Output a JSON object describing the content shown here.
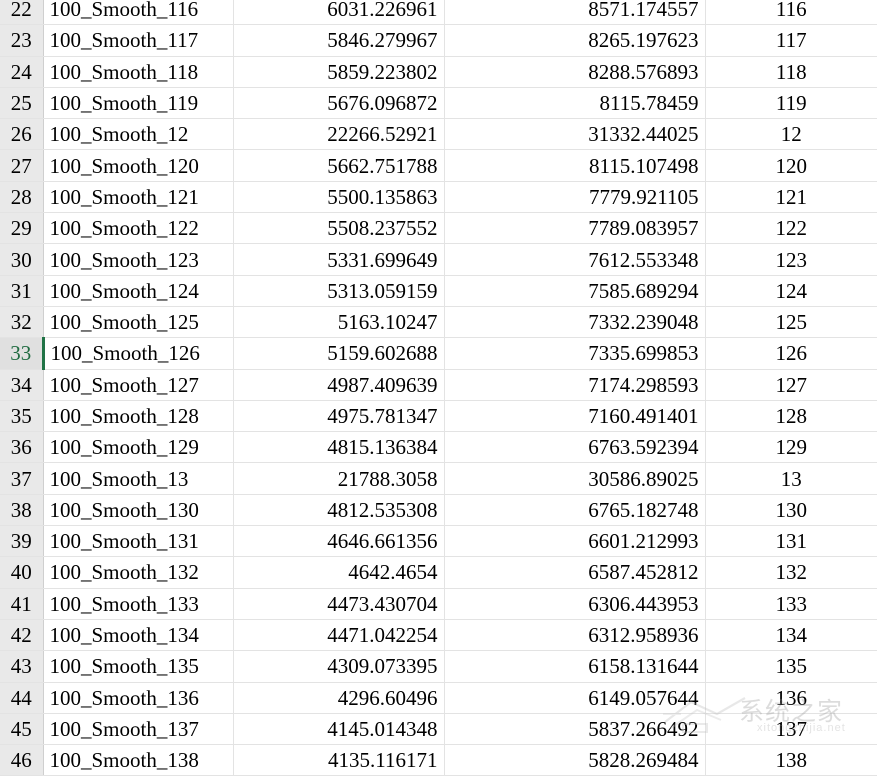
{
  "spreadsheet": {
    "active_row_number": "33",
    "accent_color": "#217346",
    "row_header_bg": "#e9e9e9",
    "gridline_color": "#e3e3e3",
    "columns": [
      {
        "key": "label",
        "align": "left"
      },
      {
        "key": "value1",
        "align": "right"
      },
      {
        "key": "value2",
        "align": "right"
      },
      {
        "key": "index",
        "align": "center"
      }
    ],
    "rows": [
      {
        "row": "22",
        "label": "100_Smooth_116",
        "value1": "6031.226961",
        "value2": "8571.174557",
        "index": "116"
      },
      {
        "row": "23",
        "label": "100_Smooth_117",
        "value1": "5846.279967",
        "value2": "8265.197623",
        "index": "117"
      },
      {
        "row": "24",
        "label": "100_Smooth_118",
        "value1": "5859.223802",
        "value2": "8288.576893",
        "index": "118"
      },
      {
        "row": "25",
        "label": "100_Smooth_119",
        "value1": "5676.096872",
        "value2": "8115.78459",
        "index": "119"
      },
      {
        "row": "26",
        "label": "100_Smooth_12",
        "value1": "22266.52921",
        "value2": "31332.44025",
        "index": "12"
      },
      {
        "row": "27",
        "label": "100_Smooth_120",
        "value1": "5662.751788",
        "value2": "8115.107498",
        "index": "120"
      },
      {
        "row": "28",
        "label": "100_Smooth_121",
        "value1": "5500.135863",
        "value2": "7779.921105",
        "index": "121"
      },
      {
        "row": "29",
        "label": "100_Smooth_122",
        "value1": "5508.237552",
        "value2": "7789.083957",
        "index": "122"
      },
      {
        "row": "30",
        "label": "100_Smooth_123",
        "value1": "5331.699649",
        "value2": "7612.553348",
        "index": "123"
      },
      {
        "row": "31",
        "label": "100_Smooth_124",
        "value1": "5313.059159",
        "value2": "7585.689294",
        "index": "124"
      },
      {
        "row": "32",
        "label": "100_Smooth_125",
        "value1": "5163.10247",
        "value2": "7332.239048",
        "index": "125"
      },
      {
        "row": "33",
        "label": "100_Smooth_126",
        "value1": "5159.602688",
        "value2": "7335.699853",
        "index": "126"
      },
      {
        "row": "34",
        "label": "100_Smooth_127",
        "value1": "4987.409639",
        "value2": "7174.298593",
        "index": "127"
      },
      {
        "row": "35",
        "label": "100_Smooth_128",
        "value1": "4975.781347",
        "value2": "7160.491401",
        "index": "128"
      },
      {
        "row": "36",
        "label": "100_Smooth_129",
        "value1": "4815.136384",
        "value2": "6763.592394",
        "index": "129"
      },
      {
        "row": "37",
        "label": "100_Smooth_13",
        "value1": "21788.3058",
        "value2": "30586.89025",
        "index": "13"
      },
      {
        "row": "38",
        "label": "100_Smooth_130",
        "value1": "4812.535308",
        "value2": "6765.182748",
        "index": "130"
      },
      {
        "row": "39",
        "label": "100_Smooth_131",
        "value1": "4646.661356",
        "value2": "6601.212993",
        "index": "131"
      },
      {
        "row": "40",
        "label": "100_Smooth_132",
        "value1": "4642.4654",
        "value2": "6587.452812",
        "index": "132"
      },
      {
        "row": "41",
        "label": "100_Smooth_133",
        "value1": "4473.430704",
        "value2": "6306.443953",
        "index": "133"
      },
      {
        "row": "42",
        "label": "100_Smooth_134",
        "value1": "4471.042254",
        "value2": "6312.958936",
        "index": "134"
      },
      {
        "row": "43",
        "label": "100_Smooth_135",
        "value1": "4309.073395",
        "value2": "6158.131644",
        "index": "135"
      },
      {
        "row": "44",
        "label": "100_Smooth_136",
        "value1": "4296.60496",
        "value2": "6149.057644",
        "index": "136"
      },
      {
        "row": "45",
        "label": "100_Smooth_137",
        "value1": "4145.014348",
        "value2": "5837.266492",
        "index": "137"
      },
      {
        "row": "46",
        "label": "100_Smooth_138",
        "value1": "4135.116171",
        "value2": "5828.269484",
        "index": "138"
      }
    ]
  },
  "watermark": {
    "text": "系统之家",
    "subtext": "xitongzhijia.net"
  }
}
